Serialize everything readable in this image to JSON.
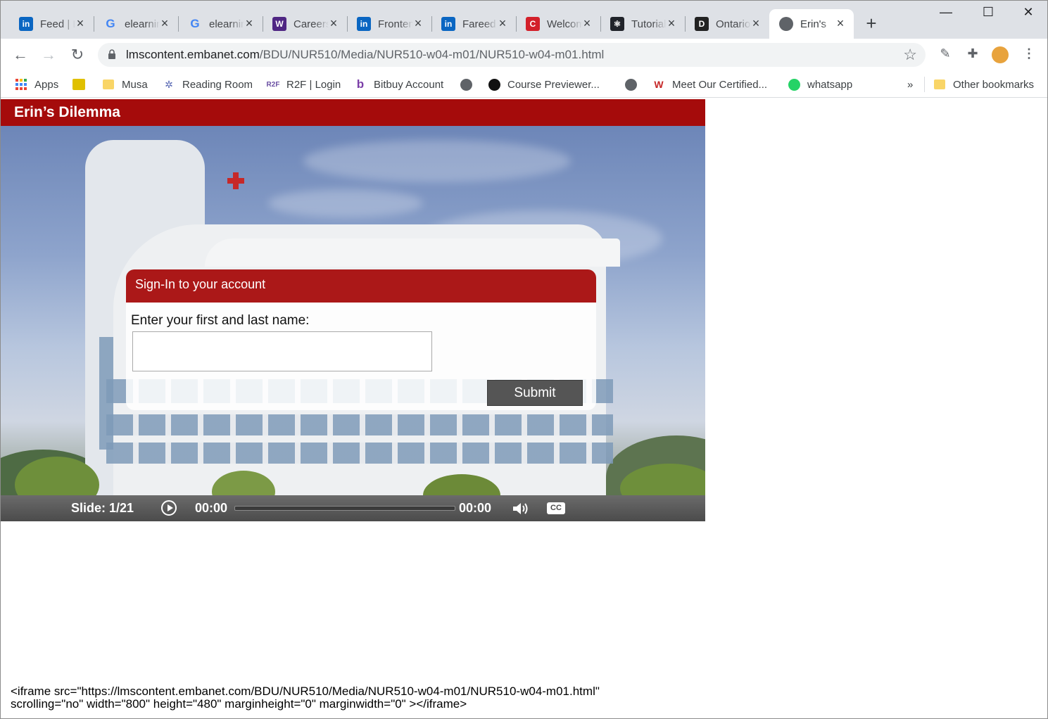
{
  "browser": {
    "tabs": [
      {
        "title": "Feed | LinkedIn",
        "icon": "linkedin-icon",
        "color": "#0a66c2",
        "glyph": "in"
      },
      {
        "title": "elearning",
        "icon": "google-icon",
        "color": "#4285f4",
        "glyph": "G"
      },
      {
        "title": "elearning",
        "icon": "google-icon",
        "color": "#4285f4",
        "glyph": "G"
      },
      {
        "title": "Careers",
        "icon": "western-crest-icon",
        "color": "#4f2683",
        "glyph": "W"
      },
      {
        "title": "Frontend",
        "icon": "linkedin-icon",
        "color": "#0a66c2",
        "glyph": "in"
      },
      {
        "title": "Fareed",
        "icon": "linkedin-icon",
        "color": "#0a66c2",
        "glyph": "in"
      },
      {
        "title": "Welcome",
        "icon": "c-logo-icon",
        "color": "#d3202a",
        "glyph": "C"
      },
      {
        "title": "Tutorial",
        "icon": "react-icon",
        "color": "#20232a",
        "glyph": "⚛"
      },
      {
        "title": "Ontario",
        "icon": "dms-icon",
        "color": "#222222",
        "glyph": "D"
      },
      {
        "title": "Erin's",
        "icon": "globe-icon",
        "color": "#5f6368",
        "glyph": ""
      }
    ],
    "url_host": "lmscontent.embanet.com",
    "url_path": "/BDU/NUR510/Media/NUR510-w04-m01/NUR510-w04-m01.html",
    "bookmarks": [
      {
        "label": "Apps",
        "icon": "apps-grid-icon"
      },
      {
        "label": "",
        "icon": "bookmark-favicon-icon"
      },
      {
        "label": "Musa",
        "icon": "folder-icon"
      },
      {
        "label": "Reading Room",
        "icon": "reading-room-icon"
      },
      {
        "label": "R2F | Login",
        "icon": "r2f-icon"
      },
      {
        "label": "Bitbuy Account",
        "icon": "bitbuy-icon"
      },
      {
        "label": "",
        "icon": "globe-icon"
      },
      {
        "label": "Course Previewer...",
        "icon": "course-previewer-icon"
      },
      {
        "label": "",
        "icon": "globe-icon"
      },
      {
        "label": "Meet Our Certified...",
        "icon": "certified-icon"
      },
      {
        "label": "whatsapp",
        "icon": "whatsapp-icon"
      }
    ],
    "bookmarks_overflow": "»",
    "other_bookmarks": "Other bookmarks"
  },
  "slide": {
    "title": "Erin’s Dilemma",
    "dialog_title": "Sign-In to your account",
    "prompt": "Enter your first and last name:",
    "name_value": "",
    "submit_label": "Submit"
  },
  "player": {
    "slide_counter": "Slide: 1/21",
    "time_current": "00:00",
    "time_total": "00:00",
    "progress": 0,
    "cc_label": "CC"
  },
  "embed_code": "<iframe src=\"https://lmscontent.embanet.com/BDU/NUR510/Media/NUR510-w04-m01/NUR510-w04-m01.html\"\nscrolling=\"no\" width=\"800\" height=\"480\" marginheight=\"0\" marginwidth=\"0\" ></iframe>",
  "colors": {
    "header_red": "#a50b0b",
    "dialog_red": "#ab1818",
    "button_gray": "#555555"
  }
}
